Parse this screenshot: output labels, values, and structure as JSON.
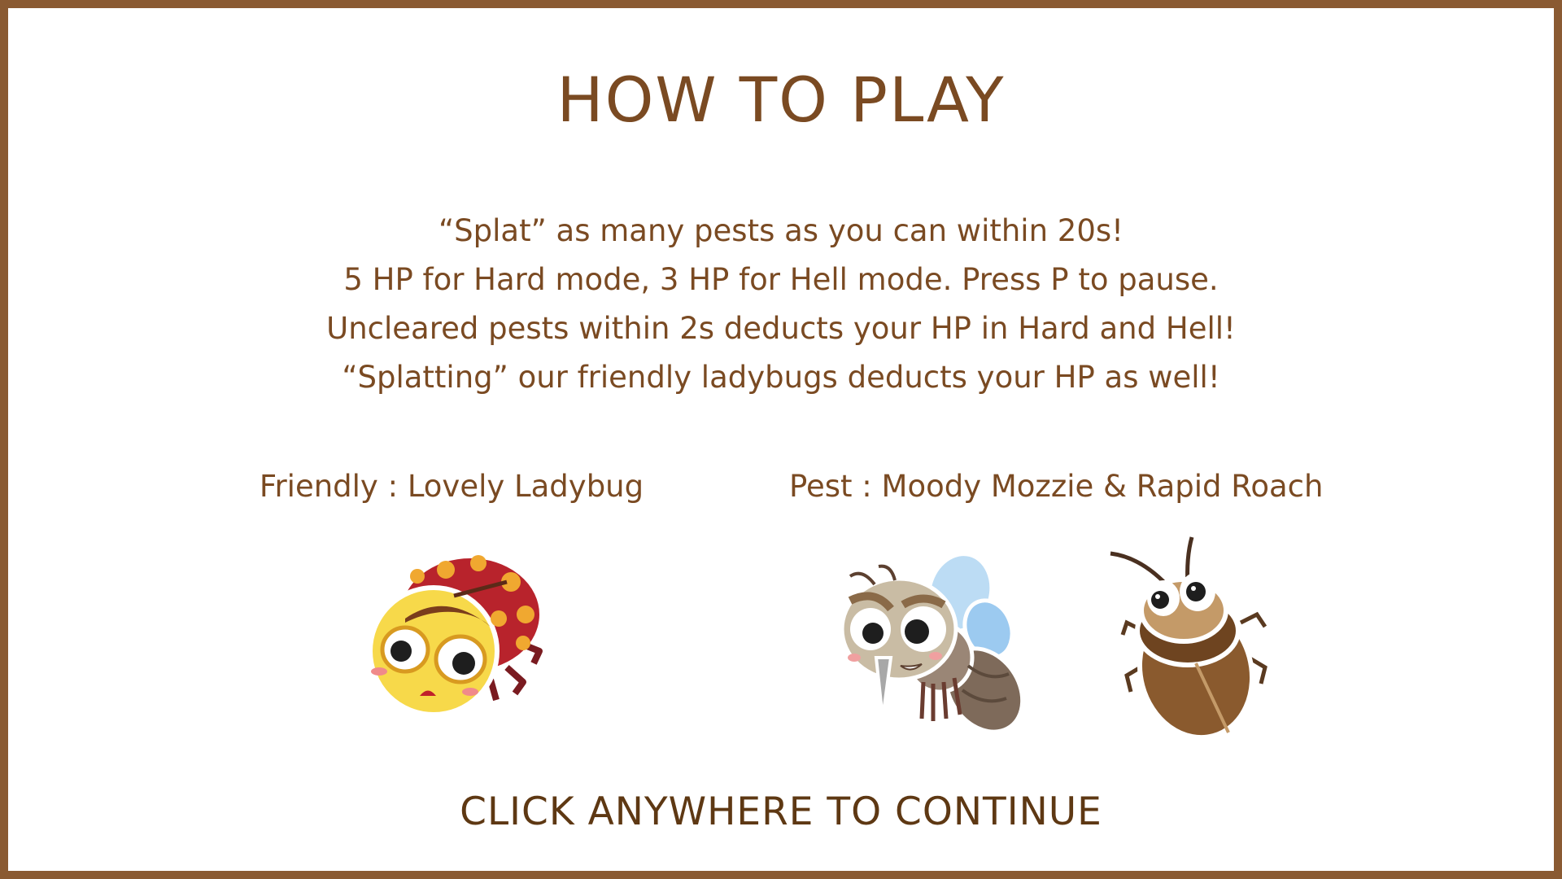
{
  "screen": {
    "title": "HOW TO PLAY",
    "instructions": [
      "“Splat” as many pests as you can within 20s!",
      "5 HP for Hard mode, 3 HP for Hell mode. Press P to pause.",
      "Uncleared pests within 2s deducts your HP in Hard and Hell!",
      "“Splatting” our friendly ladybugs deducts your HP as well!"
    ],
    "friendly_label": "Friendly : Lovely Ladybug",
    "pest_label": "Pest : Moody Mozzie & Rapid Roach",
    "continue_text": "CLICK ANYWHERE TO CONTINUE"
  },
  "characters": [
    {
      "name": "ladybug",
      "icon": "ladybug-icon"
    },
    {
      "name": "mosquito",
      "icon": "mosquito-icon"
    },
    {
      "name": "roach",
      "icon": "roach-icon"
    }
  ],
  "colors": {
    "border": "#8a5a32",
    "text": "#7a4a22",
    "continue_text": "#5e3813"
  }
}
